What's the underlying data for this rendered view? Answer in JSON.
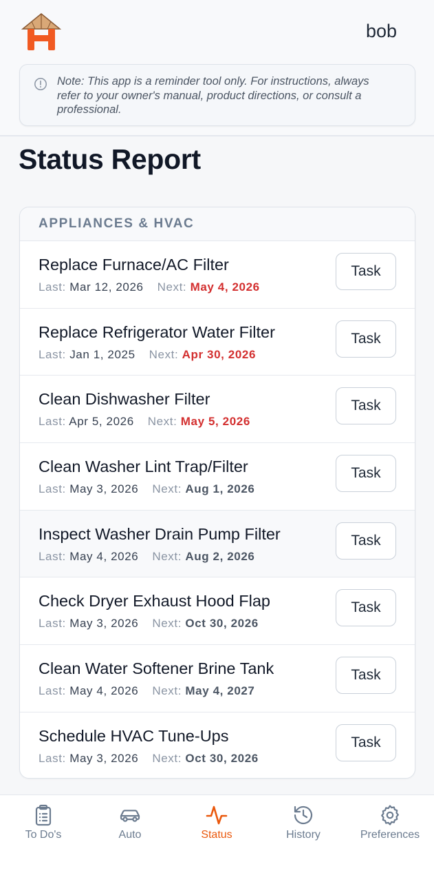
{
  "header": {
    "logo": "house-logo-icon",
    "username": "bob",
    "note": "Note: This app is a reminder tool only. For instructions, always refer to your owner's manual, product directions, or consult a professional.",
    "note_icon": "info-circle-icon"
  },
  "page": {
    "title": "Status Report"
  },
  "section": {
    "title": "APPLIANCES & HVAC",
    "last_label": "Last:",
    "next_label": "Next:",
    "button_label": "Task",
    "items": [
      {
        "title": "Replace Furnace/AC Filter",
        "last": "Mar 12, 2026",
        "next": "May 4, 2026",
        "overdue": true
      },
      {
        "title": "Replace Refrigerator Water Filter",
        "last": "Jan 1, 2025",
        "next": "Apr 30, 2026",
        "overdue": true
      },
      {
        "title": "Clean Dishwasher Filter",
        "last": "Apr 5, 2026",
        "next": "May 5, 2026",
        "overdue": true
      },
      {
        "title": "Clean Washer Lint Trap/Filter",
        "last": "May 3, 2026",
        "next": "Aug 1, 2026",
        "overdue": false
      },
      {
        "title": "Inspect Washer Drain Pump Filter",
        "last": "May 4, 2026",
        "next": "Aug 2, 2026",
        "overdue": false
      },
      {
        "title": "Check Dryer Exhaust Hood Flap",
        "last": "May 3, 2026",
        "next": "Oct 30, 2026",
        "overdue": false
      },
      {
        "title": "Clean Water Softener Brine Tank",
        "last": "May 4, 2026",
        "next": "May 4, 2027",
        "overdue": false
      },
      {
        "title": "Schedule HVAC Tune-Ups",
        "last": "May 3, 2026",
        "next": "Oct 30, 2026",
        "overdue": false
      }
    ]
  },
  "nav": {
    "active": "Status",
    "items": [
      {
        "label": "To Do's",
        "icon": "clipboard-list-icon"
      },
      {
        "label": "Auto",
        "icon": "car-icon"
      },
      {
        "label": "Status",
        "icon": "activity-pulse-icon"
      },
      {
        "label": "History",
        "icon": "history-clock-icon"
      },
      {
        "label": "Preferences",
        "icon": "gear-icon"
      }
    ]
  },
  "colors": {
    "accent": "#ea580c",
    "overdue": "#d32f2f",
    "muted": "#6b7b8f",
    "background": "#f6f7f9"
  }
}
